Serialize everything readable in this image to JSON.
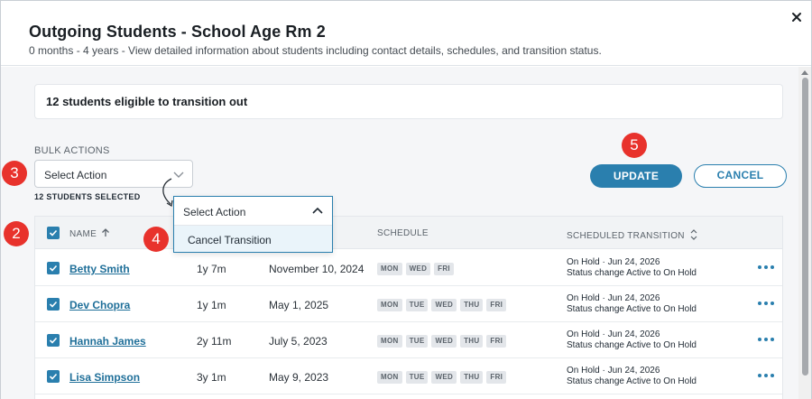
{
  "modal": {
    "title": "Outgoing Students - School Age Rm 2",
    "subtitle": "0 months - 4 years - View detailed information about students including contact details, schedules, and transition status.",
    "close_icon": "close-icon"
  },
  "eligible": {
    "text": "12 students eligible to transition out"
  },
  "bulk": {
    "label": "BULK ACTIONS",
    "select_value": "Select Action",
    "selected_count": "12 STUDENTS SELECTED"
  },
  "buttons": {
    "update": "UPDATE",
    "cancel": "CANCEL"
  },
  "dropdown": {
    "value": "Select Action",
    "options": [
      "Cancel Transition"
    ]
  },
  "table": {
    "headers": {
      "name": "NAME",
      "schedule": "SCHEDULE",
      "transition": "SCHEDULED TRANSITION"
    },
    "rows": [
      {
        "name": "Betty Smith",
        "age": "1y 7m",
        "date": "November 10, 2024",
        "days": [
          "MON",
          "WED",
          "FRI"
        ],
        "transition_line1": "On Hold · Jun 24, 2026",
        "transition_line2": "Status change Active to On Hold"
      },
      {
        "name": "Dev Chopra",
        "age": "1y 1m",
        "date": "May 1, 2025",
        "days": [
          "MON",
          "TUE",
          "WED",
          "THU",
          "FRI"
        ],
        "transition_line1": "On Hold · Jun 24, 2026",
        "transition_line2": "Status change Active to On Hold"
      },
      {
        "name": "Hannah James",
        "age": "2y 11m",
        "date": "July 5, 2023",
        "days": [
          "MON",
          "TUE",
          "WED",
          "THU",
          "FRI"
        ],
        "transition_line1": "On Hold · Jun 24, 2026",
        "transition_line2": "Status change Active to On Hold"
      },
      {
        "name": "Lisa Simpson",
        "age": "3y 1m",
        "date": "May 9, 2023",
        "days": [
          "MON",
          "TUE",
          "WED",
          "THU",
          "FRI"
        ],
        "transition_line1": "On Hold · Jun 24, 2026",
        "transition_line2": "Status change Active to On Hold"
      }
    ]
  },
  "badges": [
    "2",
    "3",
    "4",
    "5"
  ],
  "colors": {
    "accent": "#2a7fae",
    "badge": "#e8322c",
    "link": "#1f6f99"
  }
}
